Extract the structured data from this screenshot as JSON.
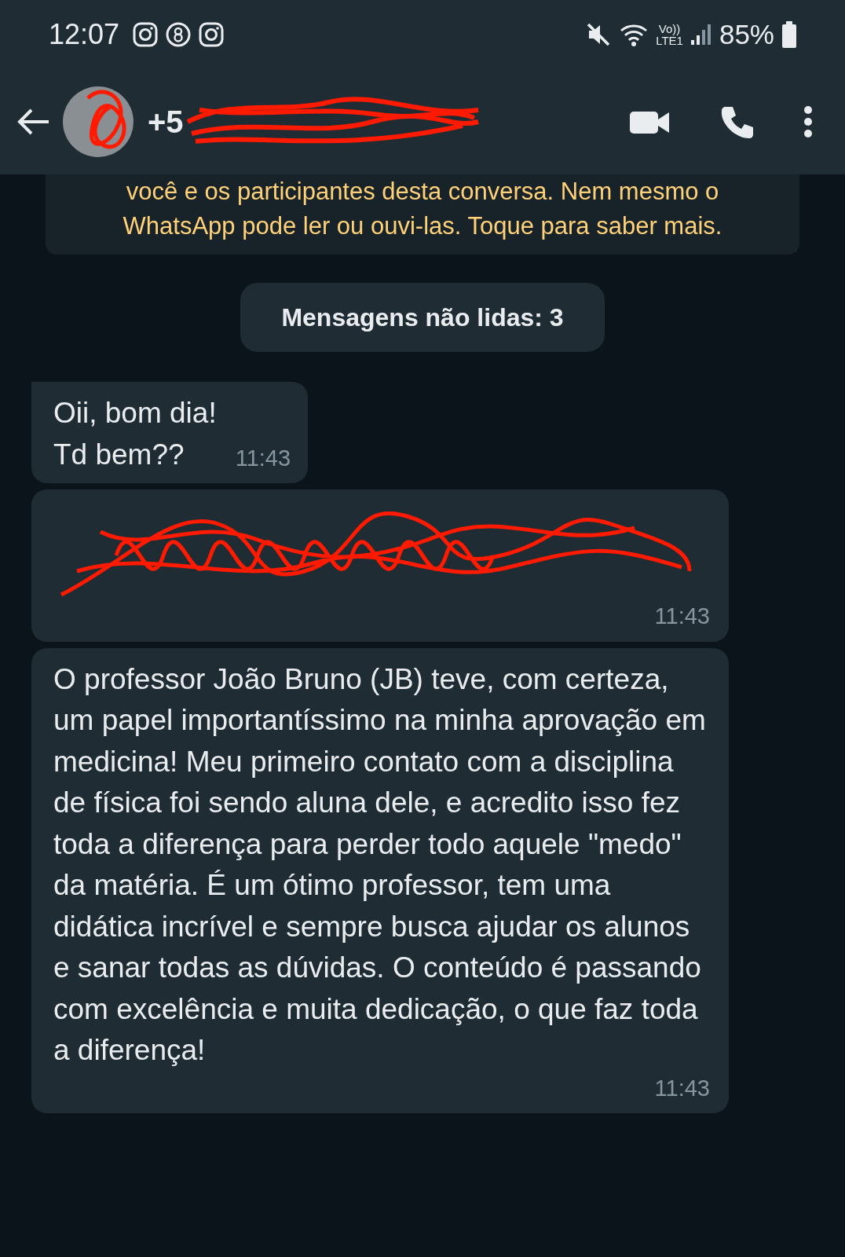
{
  "status_bar": {
    "time": "12:07",
    "network_label_top": "Vo))",
    "network_label_bottom": "LTE1",
    "battery": "85%"
  },
  "header": {
    "contact": "+5"
  },
  "encryption_notice": {
    "text": "você e os participantes desta conversa. Nem mesmo o WhatsApp pode ler ou ouvi-las. Toque para saber mais."
  },
  "unread_divider": "Mensagens não lidas: 3",
  "messages": [
    {
      "kind": "text",
      "text": "Oii, bom dia!\nTd bem??",
      "time": "11:43"
    },
    {
      "kind": "redacted",
      "time": "11:43"
    },
    {
      "kind": "text",
      "text": "O professor João Bruno (JB) teve, com certeza, um papel importantíssimo na minha aprovação em medicina! Meu primeiro contato com a disciplina de física foi sendo aluna dele, e acredito isso fez toda a diferença para perder todo aquele \"medo\" da matéria. É um ótimo professor, tem uma didática incrível e sempre busca ajudar os alunos e sanar todas as dúvidas. O conteúdo é passando com excelência e muita dedicação, o que faz toda a diferença!",
      "time": "11:43"
    }
  ]
}
